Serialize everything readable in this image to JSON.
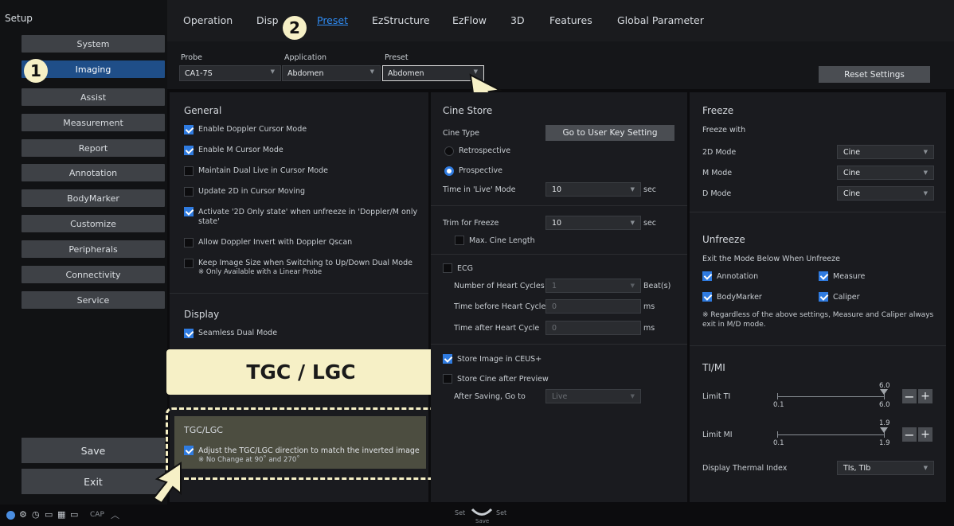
{
  "sidebar": {
    "title": "Setup",
    "items": [
      "System",
      "Imaging",
      "Assist",
      "Measurement",
      "Report",
      "Annotation",
      "BodyMarker",
      "Customize",
      "Peripherals",
      "Connectivity",
      "Service"
    ],
    "save": "Save",
    "exit": "Exit"
  },
  "tabs": [
    "Operation",
    "Disp",
    "Preset",
    "EzStructure",
    "EzFlow",
    "3D",
    "Features",
    "Global Parameter"
  ],
  "toolbar": {
    "probe_label": "Probe",
    "probe_value": "CA1-7S",
    "application_label": "Application",
    "application_value": "Abdomen",
    "preset_label": "Preset",
    "preset_value": "Abdomen",
    "reset": "Reset Settings"
  },
  "general": {
    "title": "General",
    "items": [
      {
        "label": "Enable Doppler Cursor Mode",
        "checked": true
      },
      {
        "label": "Enable M Cursor Mode",
        "checked": true
      },
      {
        "label": "Maintain Dual Live in Cursor Mode",
        "checked": false
      },
      {
        "label": "Update 2D in Cursor Moving",
        "checked": false
      },
      {
        "label": "Activate '2D Only state' when unfreeze in 'Doppler/M only",
        "label2": "state'",
        "checked": true
      },
      {
        "label": "Allow Doppler Invert with Doppler Qscan",
        "checked": false
      },
      {
        "label": "Keep Image Size when Switching to Up/Down Dual Mode",
        "label2": "※ Only Available with a Linear Probe",
        "checked": false
      }
    ]
  },
  "display": {
    "title": "Display",
    "seamless": "Seamless Dual Mode"
  },
  "tgc_callout": "TGC / LGC",
  "tgc": {
    "title": "TGC/LGC",
    "line1": "Adjust the TGC/LGC direction to match the inverted image",
    "line2": "※ No Change at 90˚ and 270˚"
  },
  "cine": {
    "title": "Cine Store",
    "cine_type": "Cine Type",
    "goto_btn": "Go to User Key Setting",
    "retro": "Retrospective",
    "prosp": "Prospective",
    "time_live": "Time in 'Live' Mode",
    "time_live_val": "10",
    "sec": "sec",
    "trim": "Trim for Freeze",
    "trim_val": "10",
    "max_cine": "Max. Cine Length",
    "ecg": "ECG",
    "num_hc": "Number of Heart Cycles",
    "num_hc_val": "1",
    "beats": "Beat(s)",
    "time_before": "Time before Heart Cycle",
    "time_before_val": "0",
    "time_after": "Time after Heart Cycle",
    "time_after_val": "0",
    "ms": "ms",
    "ceus": "Store Image in CEUS+",
    "store_after": "Store Cine after Preview",
    "after_saving": "After Saving, Go to",
    "after_saving_val": "Live"
  },
  "freeze": {
    "title": "Freeze",
    "with": "Freeze with",
    "rows": [
      {
        "label": "2D Mode",
        "value": "Cine"
      },
      {
        "label": "M Mode",
        "value": "Cine"
      },
      {
        "label": "D Mode",
        "value": "Cine"
      }
    ]
  },
  "unfreeze": {
    "title": "Unfreeze",
    "sub": "Exit the Mode Below When Unfreeze",
    "annotation": "Annotation",
    "measure": "Measure",
    "bodymarker": "BodyMarker",
    "caliper": "Caliper",
    "note1": "※ Regardless of the above settings, Measure and Caliper always",
    "note2": "exit in M/D mode."
  },
  "timi": {
    "title": "TI/MI",
    "limit_ti": "Limit TI",
    "ti_min": "0.1",
    "ti_val": "6.0",
    "ti_max": "6.0",
    "limit_mi": "Limit MI",
    "mi_min": "0.1",
    "mi_val": "1.9",
    "mi_max": "1.9",
    "display_ti": "Display Thermal Index",
    "display_ti_val": "TIs, TIb"
  },
  "bottom": {
    "set1": "Set",
    "set2": "Set",
    "save": "Save",
    "cap": "CAP"
  },
  "markers": {
    "one": "1",
    "two": "2"
  },
  "colors": {
    "accent": "#2f8cf4",
    "active_sidebar": "#1f4e88",
    "callout": "#f6f0c6"
  }
}
